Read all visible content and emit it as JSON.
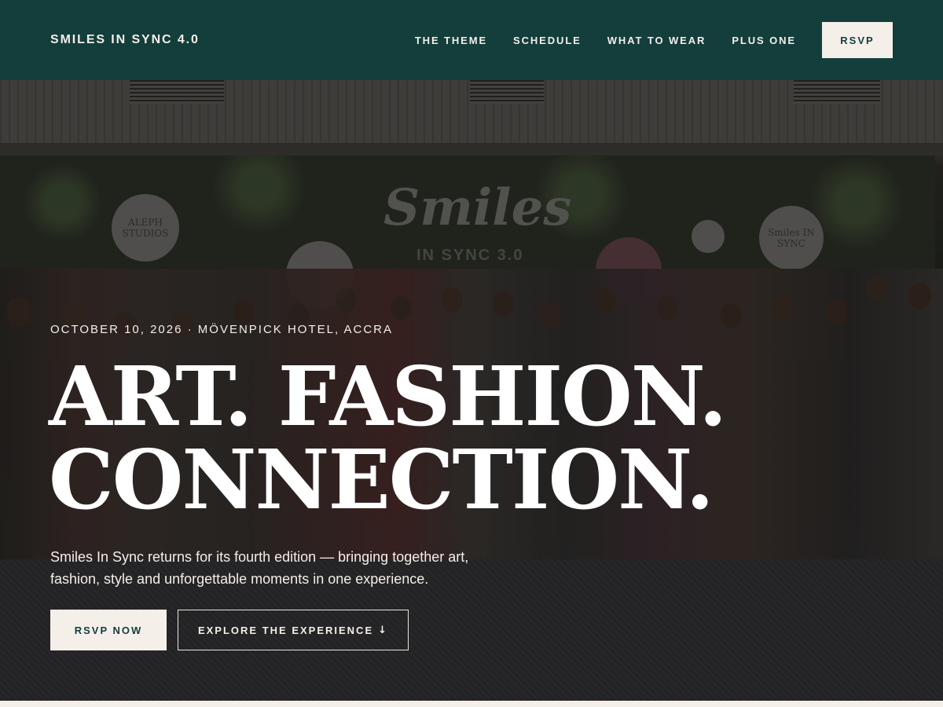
{
  "header": {
    "brand": "SMILES IN SYNC 4.0",
    "nav": [
      "THE THEME",
      "SCHEDULE",
      "WHAT TO WEAR",
      "PLUS ONE"
    ],
    "rsvp_label": "RSVP"
  },
  "hero": {
    "background": {
      "backdrop_text": "Smiles",
      "backdrop_subtext": "IN SYNC 3.0",
      "logo_left": "ALEPH STUDIOS",
      "logo_right": "Smiles IN SYNC"
    },
    "eyebrow": "OCTOBER 10, 2026 · MÖVENPICK HOTEL, ACCRA",
    "headline_line1": "ART. FASHION.",
    "headline_line2": "CONNECTION.",
    "subcopy": "Smiles In Sync returns for its fourth edition — bringing together art, fashion, style and unforgettable moments in one experience.",
    "primary_cta": "RSVP NOW",
    "secondary_cta": "EXPLORE THE EXPERIENCE",
    "secondary_cta_icon": "arrow-down-icon"
  },
  "colors": {
    "header_bg": "#133e3c",
    "cream": "#f4efe8"
  }
}
